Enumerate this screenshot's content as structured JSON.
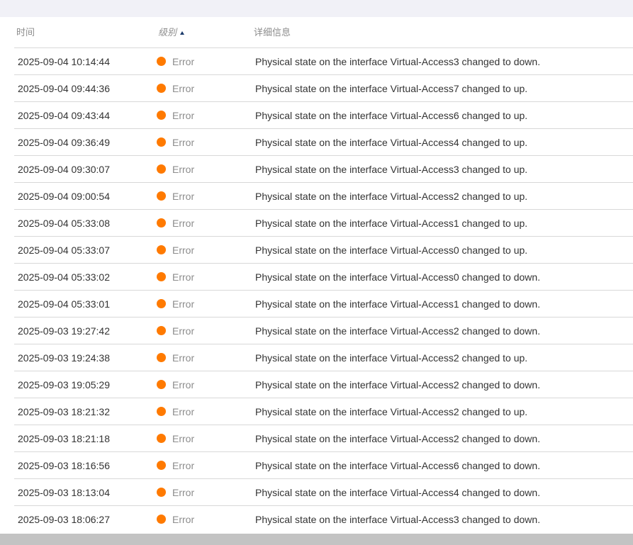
{
  "columns": {
    "time": "时间",
    "level": "级别",
    "detail": "详细信息"
  },
  "sort": {
    "column": "level",
    "direction": "ascending"
  },
  "colors": {
    "error_dot": "#ff7a00",
    "sort_arrow": "#1b3a6b",
    "top_band": "#f1f1f7",
    "scrollbar": "#c3c3c3"
  },
  "rows": [
    {
      "time": "2025-09-04 10:14:44",
      "level": "Error",
      "detail": "Physical state on the interface Virtual-Access3 changed to down."
    },
    {
      "time": "2025-09-04 09:44:36",
      "level": "Error",
      "detail": "Physical state on the interface Virtual-Access7 changed to up."
    },
    {
      "time": "2025-09-04 09:43:44",
      "level": "Error",
      "detail": "Physical state on the interface Virtual-Access6 changed to up."
    },
    {
      "time": "2025-09-04 09:36:49",
      "level": "Error",
      "detail": "Physical state on the interface Virtual-Access4 changed to up."
    },
    {
      "time": "2025-09-04 09:30:07",
      "level": "Error",
      "detail": "Physical state on the interface Virtual-Access3 changed to up."
    },
    {
      "time": "2025-09-04 09:00:54",
      "level": "Error",
      "detail": "Physical state on the interface Virtual-Access2 changed to up."
    },
    {
      "time": "2025-09-04 05:33:08",
      "level": "Error",
      "detail": "Physical state on the interface Virtual-Access1 changed to up."
    },
    {
      "time": "2025-09-04 05:33:07",
      "level": "Error",
      "detail": "Physical state on the interface Virtual-Access0 changed to up."
    },
    {
      "time": "2025-09-04 05:33:02",
      "level": "Error",
      "detail": "Physical state on the interface Virtual-Access0 changed to down."
    },
    {
      "time": "2025-09-04 05:33:01",
      "level": "Error",
      "detail": "Physical state on the interface Virtual-Access1 changed to down."
    },
    {
      "time": "2025-09-03 19:27:42",
      "level": "Error",
      "detail": "Physical state on the interface Virtual-Access2 changed to down."
    },
    {
      "time": "2025-09-03 19:24:38",
      "level": "Error",
      "detail": "Physical state on the interface Virtual-Access2 changed to up."
    },
    {
      "time": "2025-09-03 19:05:29",
      "level": "Error",
      "detail": "Physical state on the interface Virtual-Access2 changed to down."
    },
    {
      "time": "2025-09-03 18:21:32",
      "level": "Error",
      "detail": "Physical state on the interface Virtual-Access2 changed to up."
    },
    {
      "time": "2025-09-03 18:21:18",
      "level": "Error",
      "detail": "Physical state on the interface Virtual-Access2 changed to down."
    },
    {
      "time": "2025-09-03 18:16:56",
      "level": "Error",
      "detail": "Physical state on the interface Virtual-Access6 changed to down."
    },
    {
      "time": "2025-09-03 18:13:04",
      "level": "Error",
      "detail": "Physical state on the interface Virtual-Access4 changed to down."
    },
    {
      "time": "2025-09-03 18:06:27",
      "level": "Error",
      "detail": "Physical state on the interface Virtual-Access3 changed to down."
    }
  ]
}
